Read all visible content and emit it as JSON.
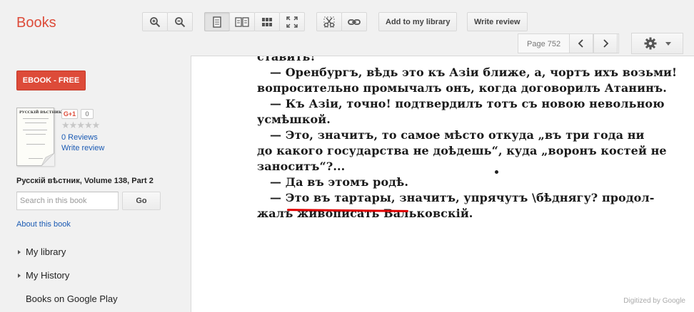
{
  "app": {
    "brand": "Books"
  },
  "toolbar": {
    "add_library_label": "Add to my library",
    "write_review_label": "Write review"
  },
  "pagination": {
    "page_label": "Page 752"
  },
  "sidebar": {
    "ebook_label": "EBOOK - FREE",
    "cover_title": "РУССКIЙ ВѢСТНИКЪ",
    "gplus_label": "G+1",
    "gplus_count": "0",
    "rating_stars": "★★★★★",
    "reviews_link": "0 Reviews",
    "write_review_link": "Write review",
    "book_title": "Русскій вѣстник, Volume 138, Part 2",
    "search": {
      "placeholder": "Search in this book",
      "button_label": "Go"
    },
    "about_link": "About this book",
    "nav": [
      {
        "label": "My library"
      },
      {
        "label": "My History"
      },
      {
        "label": "Books on Google Play"
      }
    ]
  },
  "page_text": [
    "ставить!“",
    "— Оренбургъ, вѣдь это къ Азіи ближе, а, чортъ ихъ возьми!",
    "вопросительно промычалъ онъ, когда договорилъ Атанинъ.",
    "— Къ Азіи, точно! подтвердилъ тотъ съ новою невольною",
    "усмѣшкой.",
    "— Это, значитъ, то самое мѣсто откуда „въ три года  ни",
    "до какого государства не доѣдешь“, куда „воронъ костей не",
    "заноситъ“?...",
    "— Да въ этомъ родѣ.",
    "— Это въ тартары,  значитъ, упрячутъ \\бѣднягу? продол-",
    "жалъ живописать Вальковскій."
  ],
  "footer": {
    "digitized": "Digitized by Google"
  },
  "colors": {
    "brand": "#dd4b39",
    "link": "#1a5ab3",
    "underline": "#e00000"
  }
}
